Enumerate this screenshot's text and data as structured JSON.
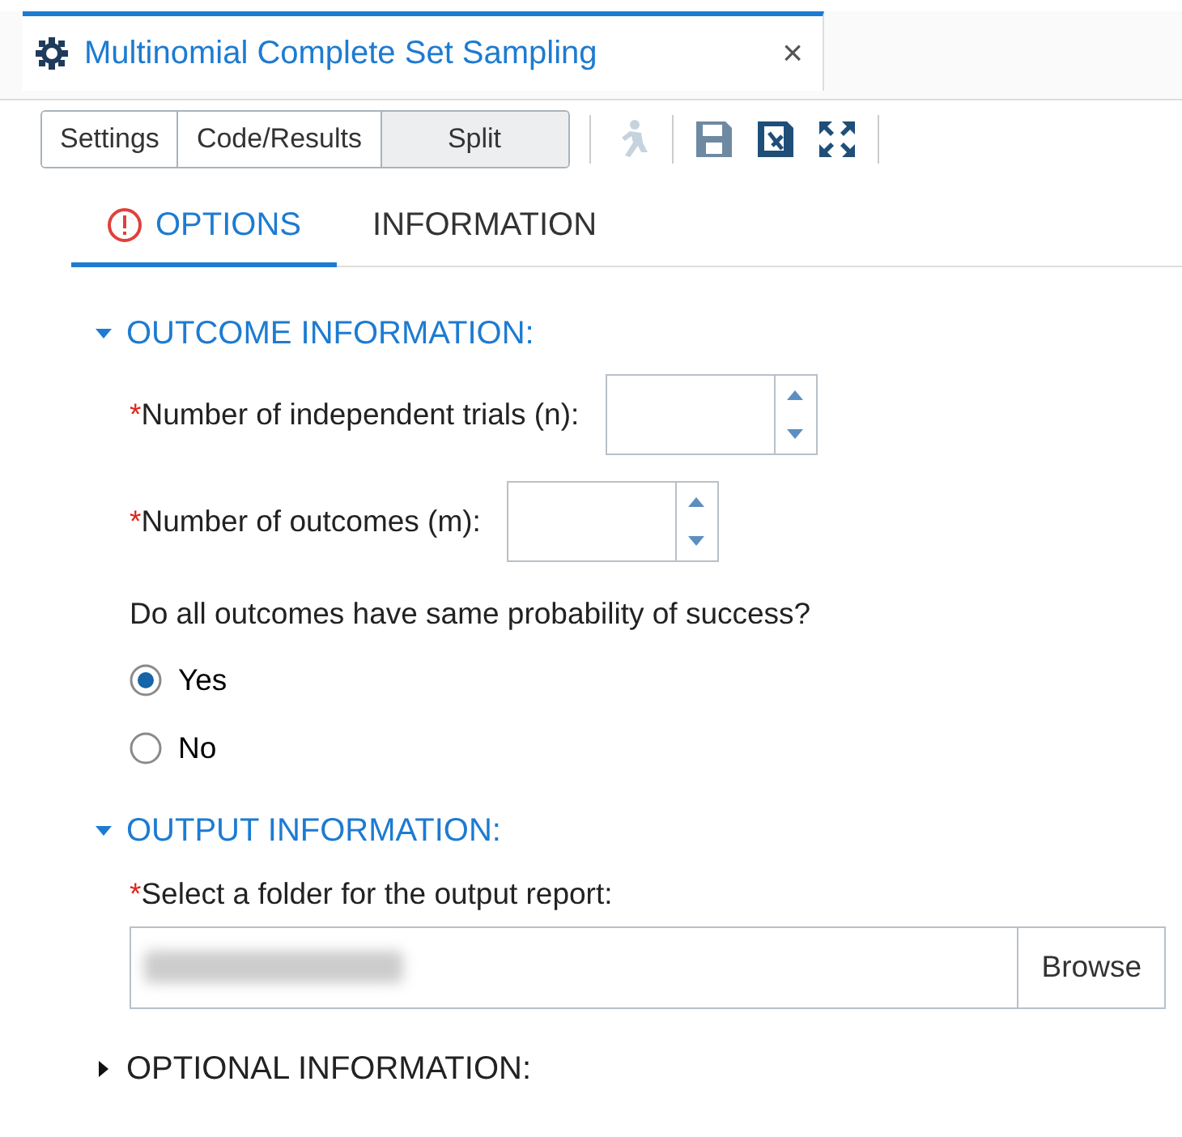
{
  "window": {
    "title": "Multinomial Complete Set Sampling",
    "close": "×"
  },
  "view_modes": [
    {
      "label": "Settings",
      "selected": false
    },
    {
      "label": "Code/Results",
      "selected": false
    },
    {
      "label": "Split",
      "selected": true
    }
  ],
  "toolbar": [
    {
      "kind": "run",
      "disabled": true
    },
    {
      "kind": "save",
      "disabled": false
    },
    {
      "kind": "saveas",
      "disabled": false
    },
    {
      "kind": "maximize",
      "disabled": false
    }
  ],
  "tabs": [
    {
      "label": "OPTIONS",
      "selected": true,
      "error": true
    },
    {
      "label": "INFORMATION",
      "selected": false,
      "error": false
    }
  ],
  "sections": [
    {
      "title": "OUTCOME INFORMATION:",
      "expanded": true,
      "items": [
        {
          "kind": "spinner",
          "required_mark": "*",
          "label": "Number of independent trials (n):"
        },
        {
          "kind": "spinner",
          "required_mark": "*",
          "label": "Number of outcomes (m):"
        },
        {
          "kind": "radio",
          "label": "Do all outcomes have same probability of success?",
          "options": [
            {
              "label": "Yes",
              "selected": true
            },
            {
              "label": "No",
              "selected": false
            }
          ]
        }
      ]
    },
    {
      "title": "OUTPUT INFORMATION:",
      "expanded": true,
      "items": [
        {
          "kind": "folder",
          "required_mark": "*",
          "label": "Select a folder for the output report:",
          "value_redacted": true,
          "button": "Browse"
        }
      ]
    },
    {
      "title": "OPTIONAL INFORMATION:",
      "expanded": false
    }
  ]
}
